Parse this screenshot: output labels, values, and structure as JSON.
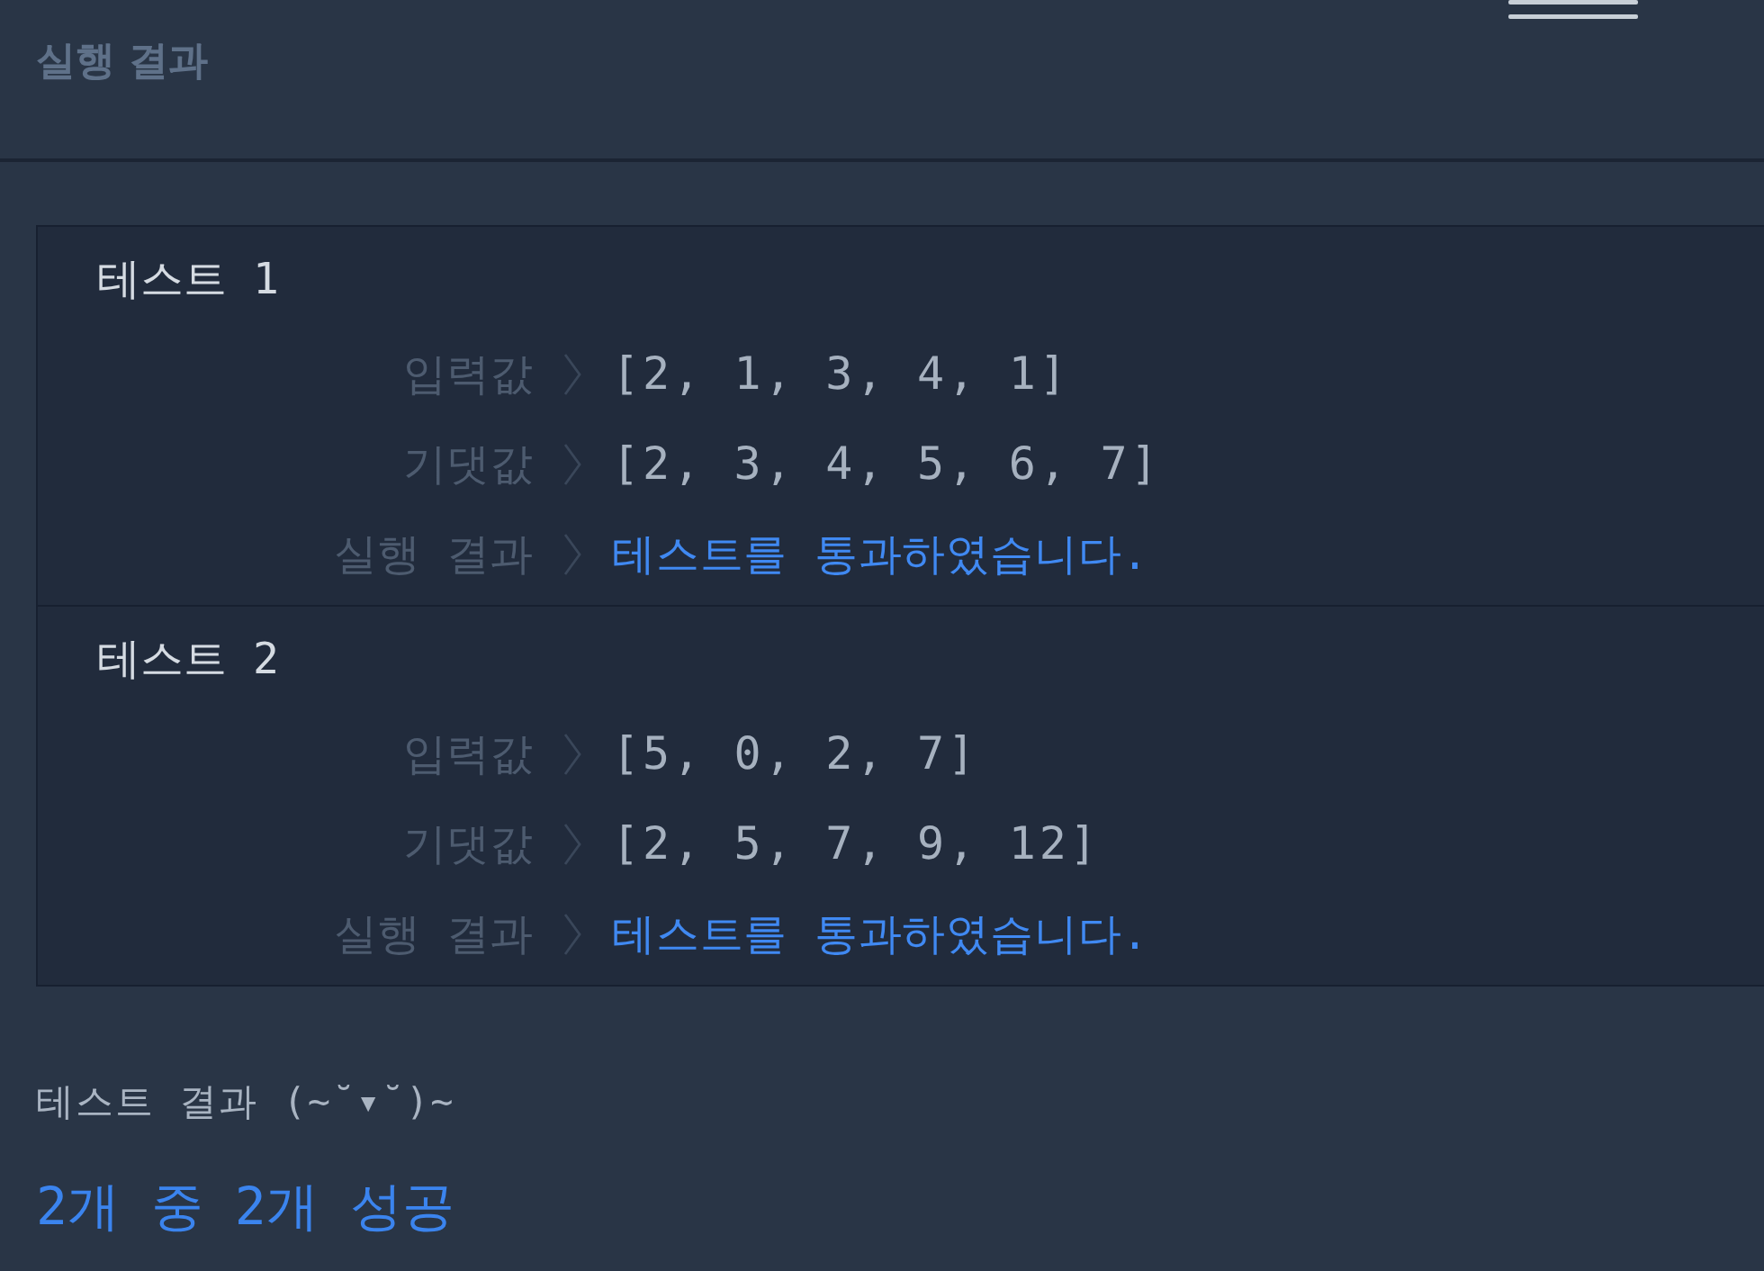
{
  "header": {
    "title": "실행 결과"
  },
  "tests": [
    {
      "title": "테스트 1",
      "rows": [
        {
          "kind": "io",
          "label": "입력값",
          "value": "[2, 1, 3, 4, 1]"
        },
        {
          "kind": "io",
          "label": "기댓값",
          "value": "[2, 3, 4, 5, 6, 7]"
        },
        {
          "kind": "result",
          "label": "실행 결과",
          "value": "테스트를 통과하였습니다."
        }
      ]
    },
    {
      "title": "테스트 2",
      "rows": [
        {
          "kind": "io",
          "label": "입력값",
          "value": "[5, 0, 2, 7]"
        },
        {
          "kind": "io",
          "label": "기댓값",
          "value": "[2, 5, 7, 9, 12]"
        },
        {
          "kind": "result",
          "label": "실행 결과",
          "value": "테스트를 통과하였습니다."
        }
      ]
    }
  ],
  "summary": {
    "title": "테스트 결과 (~˘▾˘)~",
    "result": "2개 중 2개 성공"
  }
}
